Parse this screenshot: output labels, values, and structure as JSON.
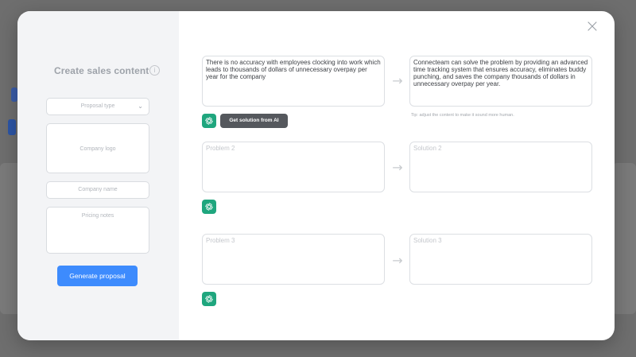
{
  "left_panel": {
    "title": "Create sales content",
    "info_icon": "i",
    "proposal_type_placeholder": "Proposal type",
    "company_logo_placeholder": "Company logo",
    "company_name_placeholder": "Company name",
    "pricing_notes_placeholder": "Pricing notes",
    "generate_button": "Generate proposal"
  },
  "close_icon": "×",
  "rows": [
    {
      "problem": "There is no accuracy with employees clocking into work which leads to thousands of dollars of unnecessary overpay per year for the company",
      "solution": "Connecteam can solve the problem by providing an advanced time tracking system that ensures accuracy, eliminates buddy punching, and saves the company thousands of dollars in unnecessary overpay per year."
    },
    {
      "problem_placeholder": "Problem 2",
      "solution_placeholder": "Solution 2"
    },
    {
      "problem_placeholder": "Problem 3",
      "solution_placeholder": "Solution 3"
    }
  ],
  "ai_button": "Get solution from AI",
  "tip": "Tip: adjust the content to make it sound more human.",
  "arrow_glyph": "→",
  "chevron_glyph": "⌄",
  "colors": {
    "primary_button": "#3d8bfd",
    "ai_icon": "#1fa67e",
    "ai_button": "#55585d",
    "backdrop": "#6e6e6e"
  },
  "icons": [
    "info-icon",
    "close-icon",
    "arrow-right-icon",
    "chatgpt-icon",
    "chevron-down-icon"
  ]
}
